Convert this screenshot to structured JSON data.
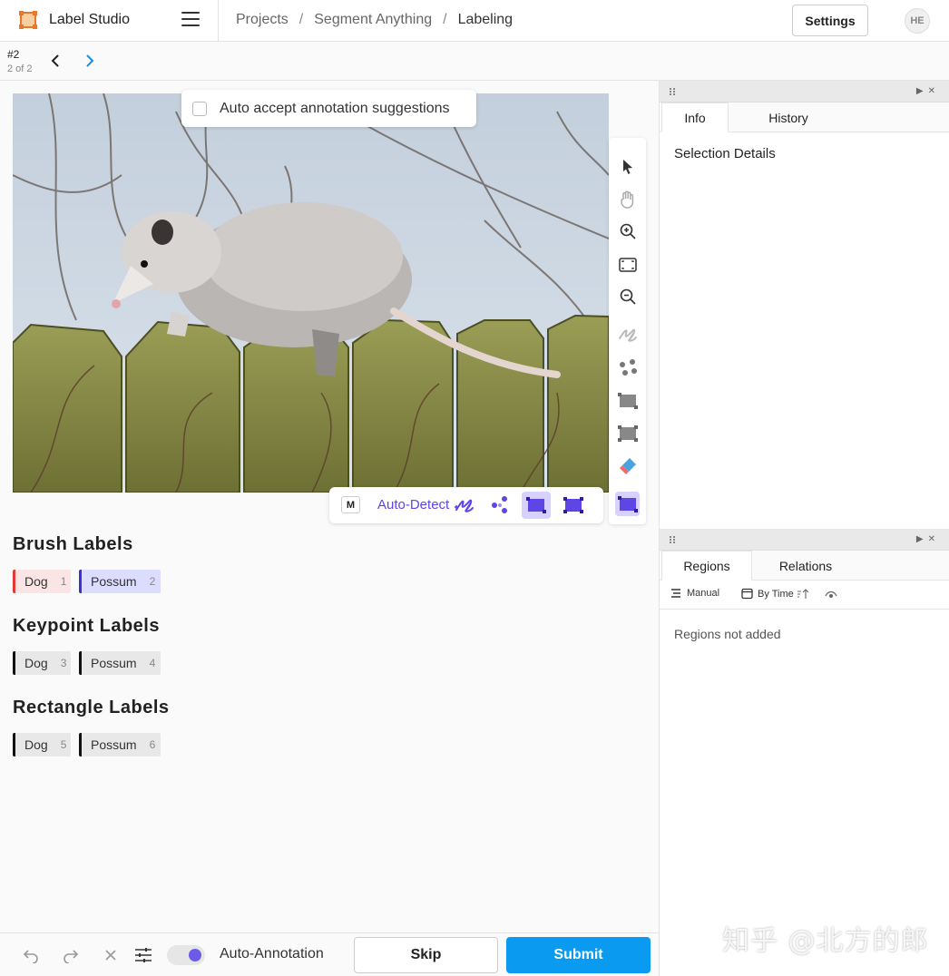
{
  "header": {
    "app_title": "Label Studio",
    "breadcrumb": [
      "Projects",
      "Segment Anything",
      "Labeling"
    ],
    "breadcrumb_sep": "/",
    "settings_label": "Settings",
    "avatar_initials": "HE"
  },
  "task_nav": {
    "task_id": "#2",
    "task_count": "2 of 2"
  },
  "canvas": {
    "auto_accept_label": "Auto accept annotation suggestions",
    "auto_accept_checked": false
  },
  "tool_strip": {
    "hotkey": "M",
    "auto_detect_label": "Auto-Detect"
  },
  "label_groups": [
    {
      "title": "Brush Labels",
      "labels": [
        {
          "name": "Dog",
          "hotkey": "1",
          "color": "#e53935",
          "bg": "#fbe4e4"
        },
        {
          "name": "Possum",
          "hotkey": "2",
          "color": "#3b2fd6",
          "bg": "#dcdcff"
        }
      ]
    },
    {
      "title": "Keypoint Labels",
      "labels": [
        {
          "name": "Dog",
          "hotkey": "3",
          "color": "#111111",
          "bg": "#e8e8e8"
        },
        {
          "name": "Possum",
          "hotkey": "4",
          "color": "#111111",
          "bg": "#e8e8e8"
        }
      ]
    },
    {
      "title": "Rectangle Labels",
      "labels": [
        {
          "name": "Dog",
          "hotkey": "5",
          "color": "#111111",
          "bg": "#e8e8e8"
        },
        {
          "name": "Possum",
          "hotkey": "6",
          "color": "#111111",
          "bg": "#e8e8e8"
        }
      ]
    }
  ],
  "info_panel": {
    "tabs": [
      "Info",
      "History"
    ],
    "active_tab": "Info",
    "section_title": "Selection Details"
  },
  "regions_panel": {
    "tabs": [
      "Regions",
      "Relations"
    ],
    "active_tab": "Regions",
    "sort_manual": "Manual",
    "sort_by": "By Time",
    "empty_text": "Regions not added"
  },
  "bottom_bar": {
    "auto_annotation_label": "Auto-Annotation",
    "auto_annotation_on": true,
    "skip_label": "Skip",
    "submit_label": "Submit"
  },
  "watermark": "知乎 @北方的郎",
  "colors": {
    "accent": "#5d45e6",
    "submit": "#0a9bf1"
  },
  "icons": [
    "logo-icon",
    "hamburger-icon",
    "chevron-left-icon",
    "chevron-right-icon",
    "pointer-icon",
    "hand-icon",
    "zoom-in-icon",
    "fit-icon",
    "zoom-out-icon",
    "brush-icon",
    "keypoint-icon",
    "rectangle-icon",
    "rectangle-alt-icon",
    "eraser-icon",
    "undo-icon",
    "redo-icon",
    "close-icon",
    "settings-sliders-icon"
  ]
}
